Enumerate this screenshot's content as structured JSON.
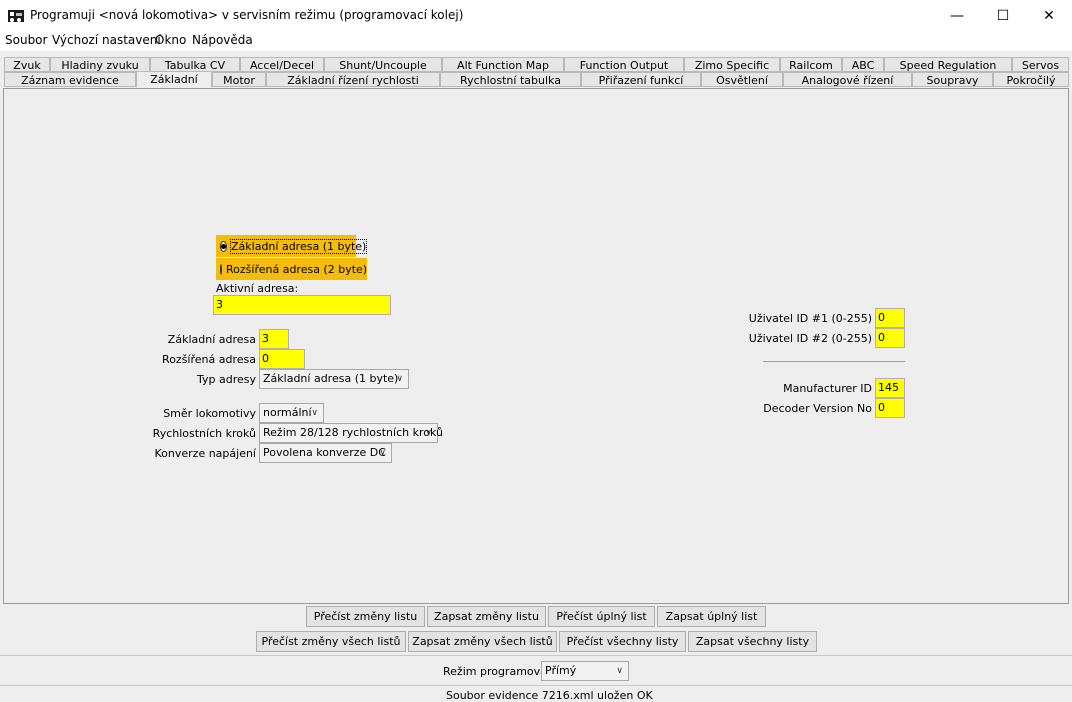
{
  "window": {
    "title": "Programuji <nová lokomotiva> v servisním režimu (programovací kolej)",
    "icon": "locomotive-icon",
    "controls": {
      "minimize": "—",
      "maximize": "☐",
      "close": "✕"
    }
  },
  "menu": [
    "Soubor",
    "Výchozí nastavení",
    "Okno",
    "Nápověda"
  ],
  "tabs_row1": [
    "Zvuk",
    "Hladiny zvuku",
    "Tabulka CV",
    "Accel/Decel",
    "Shunt/Uncouple",
    "Alt Function Map",
    "Function Output",
    "Zimo Specific",
    "Railcom",
    "ABC",
    "Speed Regulation",
    "Servos"
  ],
  "tabs_row2": [
    "Záznam evidence",
    "Základní",
    "Motor",
    "Základní řízení rychlosti",
    "Rychlostní tabulka",
    "Přiřazení funkcí",
    "Osvětlení",
    "Analogové řízení",
    "Soupravy",
    "Pokročilý"
  ],
  "active_tab": "Základní",
  "address_mode": {
    "short_label": "Základní adresa (1 byte)",
    "long_label": "Rozšířená adresa (2 byte)",
    "selected": "short",
    "active_label": "Aktivní adresa:",
    "active_value": "3"
  },
  "fields": {
    "short_address_label": "Základní adresa",
    "short_address_value": "3",
    "long_address_label": "Rozšířená adresa",
    "long_address_value": "0",
    "address_type_label": "Typ adresy",
    "address_type_value": "Základní adresa (1 byte)",
    "direction_label": "Směr lokomotivy",
    "direction_value": "normální",
    "speed_steps_label": "Rychlostních kroků",
    "speed_steps_value": "Režim 28/128 rychlostních kroků",
    "power_conversion_label": "Konverze napájení",
    "power_conversion_value": "Povolena konverze DC"
  },
  "ids": {
    "user_id1_label": "Uživatel ID #1 (0-255)",
    "user_id1_value": "0",
    "user_id2_label": "Uživatel ID #2 (0-255)",
    "user_id2_value": "0",
    "manufacturer_label": "Manufacturer ID",
    "manufacturer_value": "145",
    "decoder_version_label": "Decoder Version No",
    "decoder_version_value": "0"
  },
  "buttons_row1": [
    "Přečíst změny listu",
    "Zapsat změny listu",
    "Přečíst úplný list",
    "Zapsat úplný list"
  ],
  "buttons_row2": [
    "Přečíst změny všech listů",
    "Zapsat změny všech listů",
    "Přečíst všechny listy",
    "Zapsat všechny listy"
  ],
  "programming_mode": {
    "label": "Režim programování",
    "value": "Přímý"
  },
  "status": "Soubor evidence 7216.xml uložen OK"
}
